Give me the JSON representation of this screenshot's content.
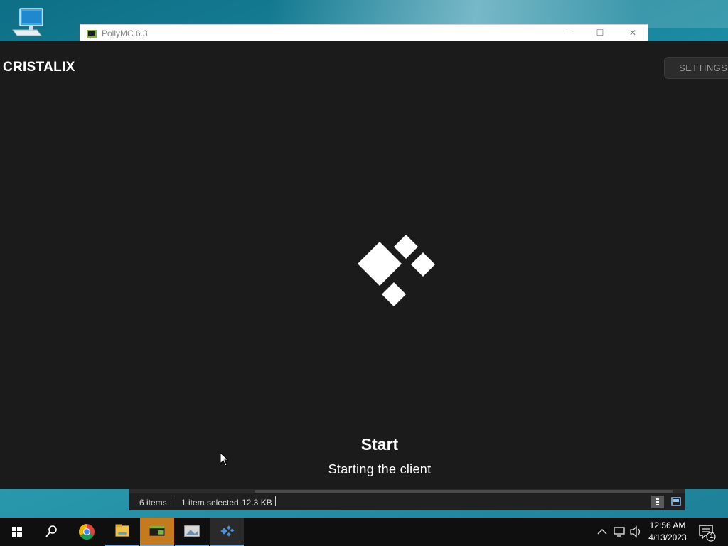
{
  "window": {
    "title": "PollyMC 6.3",
    "controls": {
      "minimize": "—",
      "maximize": "☐",
      "close": "✕"
    }
  },
  "launcher": {
    "brand": "CRISTALIX",
    "settings_label": "SETTINGS",
    "status_title": "Start",
    "status_subtitle": "Starting the client",
    "logo_icon": "cristalix-diamonds-logo"
  },
  "explorer_status": {
    "items_count": "6 items",
    "selection": "1 item selected",
    "size": "12.3 KB"
  },
  "taskbar": {
    "apps": [
      "start-icon",
      "search-icon",
      "chrome-icon",
      "file-explorer-icon",
      "pollymc-icon",
      "image-viewer-icon",
      "cristalix-icon"
    ],
    "clock": {
      "time": "12:56 AM",
      "date": "4/13/2023"
    },
    "notification_count": "1"
  },
  "colors": {
    "launcher_bg": "#1b1b1b",
    "taskbar_bg": "#0f0f0f",
    "accent": "#7aa7d6"
  }
}
